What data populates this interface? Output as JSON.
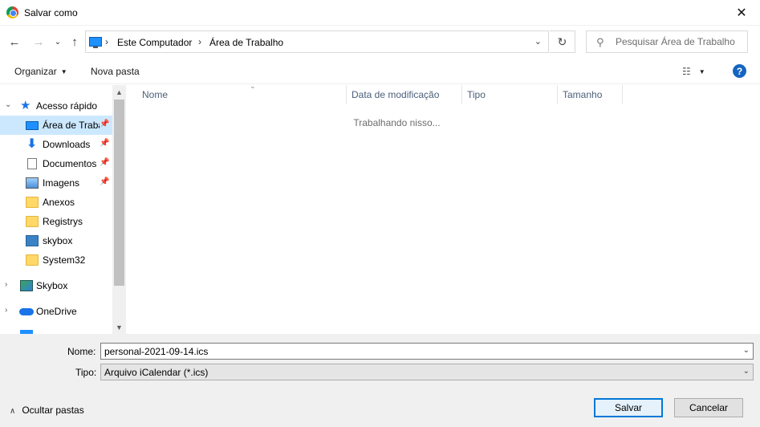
{
  "window": {
    "title": "Salvar como",
    "close_glyph": "✕"
  },
  "navbar": {
    "back_glyph": "←",
    "forward_glyph": "→",
    "recent_glyph": "⌄",
    "up_glyph": "↑",
    "breadcrumb": [
      "Este Computador",
      "Área de Trabalho"
    ],
    "breadcrumb_sep": "›",
    "dropdown_glyph": "⌄",
    "refresh_glyph": "↻",
    "search_placeholder": "Pesquisar Área de Trabalho",
    "search_glyph": "⚲"
  },
  "toolbar": {
    "organize_label": "Organizar",
    "new_folder_label": "Nova pasta",
    "caret_glyph": "▼",
    "view_glyph": "☷",
    "help_glyph": "?"
  },
  "sidebar": {
    "expand_open_glyph": "⌄",
    "expand_closed_glyph": "›",
    "pin_glyph": "📌",
    "items": [
      {
        "label": "Acesso rápido",
        "icon": "star-icon"
      },
      {
        "label": "Área de Traba",
        "icon": "desktop-icon",
        "pinned": true,
        "selected": true
      },
      {
        "label": "Downloads",
        "icon": "download-icon",
        "pinned": true
      },
      {
        "label": "Documentos",
        "icon": "document-icon",
        "pinned": true
      },
      {
        "label": "Imagens",
        "icon": "pictures-icon",
        "pinned": true
      },
      {
        "label": "Anexos",
        "icon": "folder-icon"
      },
      {
        "label": "Registrys",
        "icon": "folder-icon"
      },
      {
        "label": "skybox",
        "icon": "box-icon"
      },
      {
        "label": "System32",
        "icon": "folder-icon"
      },
      {
        "label": "Skybox",
        "icon": "skybox-icon"
      },
      {
        "label": "OneDrive",
        "icon": "cloud-icon"
      }
    ]
  },
  "scrollbar": {
    "up_glyph": "▲",
    "down_glyph": "▼"
  },
  "filelist": {
    "columns": [
      "Nome",
      "Data de modificação",
      "Tipo",
      "Tamanho"
    ],
    "sort_glyph": "⌄",
    "status_text": "Trabalhando nisso..."
  },
  "footer": {
    "name_label": "Nome:",
    "name_value": "personal-2021-09-14.ics",
    "type_label": "Tipo:",
    "type_value": "Arquivo iCalendar (*.ics)",
    "combo_glyph": "⌄",
    "hide_folders_glyph": "∧",
    "hide_folders_label": "Ocultar pastas",
    "save_label": "Salvar",
    "cancel_label": "Cancelar"
  },
  "colors": {
    "selection": "#cce8ff",
    "primary_border": "#0078d7",
    "header_text": "#4c607a"
  }
}
